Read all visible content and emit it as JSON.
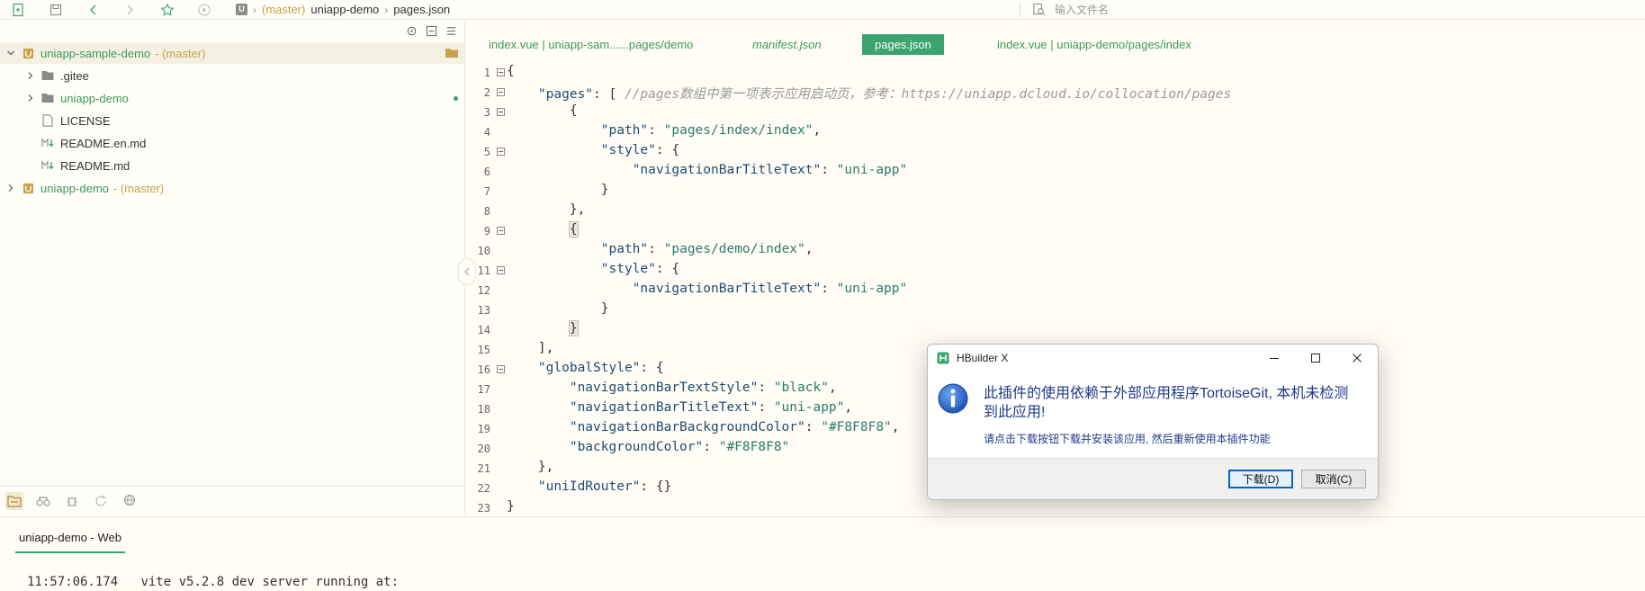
{
  "toolbar": {
    "icons": [
      "new-file-icon",
      "save-icon",
      "back-icon",
      "forward-icon",
      "star-icon",
      "run-icon"
    ]
  },
  "breadcrumb": {
    "project_badge": "U",
    "branch": "(master)",
    "project": "uniapp-demo",
    "file": "pages.json"
  },
  "file_search": {
    "placeholder": "输入文件名"
  },
  "sidebar": {
    "items": [
      {
        "label": "uniapp-sample-demo",
        "branch": "- (master)"
      },
      {
        "label": ".gitee"
      },
      {
        "label": "uniapp-demo"
      },
      {
        "label": "LICENSE"
      },
      {
        "label": "README.en.md"
      },
      {
        "label": "README.md"
      },
      {
        "label": "uniapp-demo",
        "branch": "- (master)"
      }
    ]
  },
  "tabs": [
    {
      "label": "index.vue | uniapp-sam......pages/demo"
    },
    {
      "label": "manifest.json"
    },
    {
      "label": "pages.json"
    },
    {
      "label": "index.vue | uniapp-demo/pages/index"
    }
  ],
  "code": {
    "line_numbers": [
      "1",
      "2",
      "3",
      "4",
      "5",
      "6",
      "7",
      "8",
      "9",
      "10",
      "11",
      "12",
      "13",
      "14",
      "15",
      "16",
      "17",
      "18",
      "19",
      "20",
      "21",
      "22",
      "23"
    ],
    "l1": "{",
    "l2_key": "\"pages\"",
    "l2_rest": ": [ ",
    "l2_comment": "//pages数组中第一项表示应用启动页，参考：https://uniapp.dcloud.io/collocation/pages",
    "l3": "{",
    "l4_key": "\"path\"",
    "l4_val": "\"pages/index/index\"",
    "l5_key": "\"style\"",
    "l5_rest": ": {",
    "l6_key": "\"navigationBarTitleText\"",
    "l6_val": "\"uni-app\"",
    "l7": "}",
    "l8": "},",
    "l9": "{",
    "l10_key": "\"path\"",
    "l10_val": "\"pages/demo/index\"",
    "l11_key": "\"style\"",
    "l11_rest": ": {",
    "l12_key": "\"navigationBarTitleText\"",
    "l12_val": "\"uni-app\"",
    "l13": "}",
    "l14": "}",
    "l15": "],",
    "l16_key": "\"globalStyle\"",
    "l16_rest": ": {",
    "l17_key": "\"navigationBarTextStyle\"",
    "l17_val": "\"black\"",
    "l18_key": "\"navigationBarTitleText\"",
    "l18_val": "\"uni-app\"",
    "l19_key": "\"navigationBarBackgroundColor\"",
    "l19_val": "\"#F8F8F8\"",
    "l20_key": "\"backgroundColor\"",
    "l20_val": "\"#F8F8F8\"",
    "l21": "},",
    "l22_key": "\"uniIdRouter\"",
    "l22_rest": ": {}",
    "l23": "}"
  },
  "console": {
    "tab_label": "uniapp-demo - Web",
    "time": "11:57:06.174",
    "message": "vite v5.2.8 dev server running at:"
  },
  "dialog": {
    "title": "HBuilder X",
    "message": "此插件的使用依赖于外部应用程序TortoiseGit, 本机未检测到此应用!",
    "sub_message": "请点击下载按钮下载并安装该应用, 然后重新使用本插件功能",
    "download_label": "下载(D)",
    "cancel_label": "取消(C)"
  },
  "colors": {
    "accent": "#3aa36e",
    "branch": "#c7a04a",
    "code_key": "#1f4c73",
    "code_string": "#2b7a6e"
  }
}
